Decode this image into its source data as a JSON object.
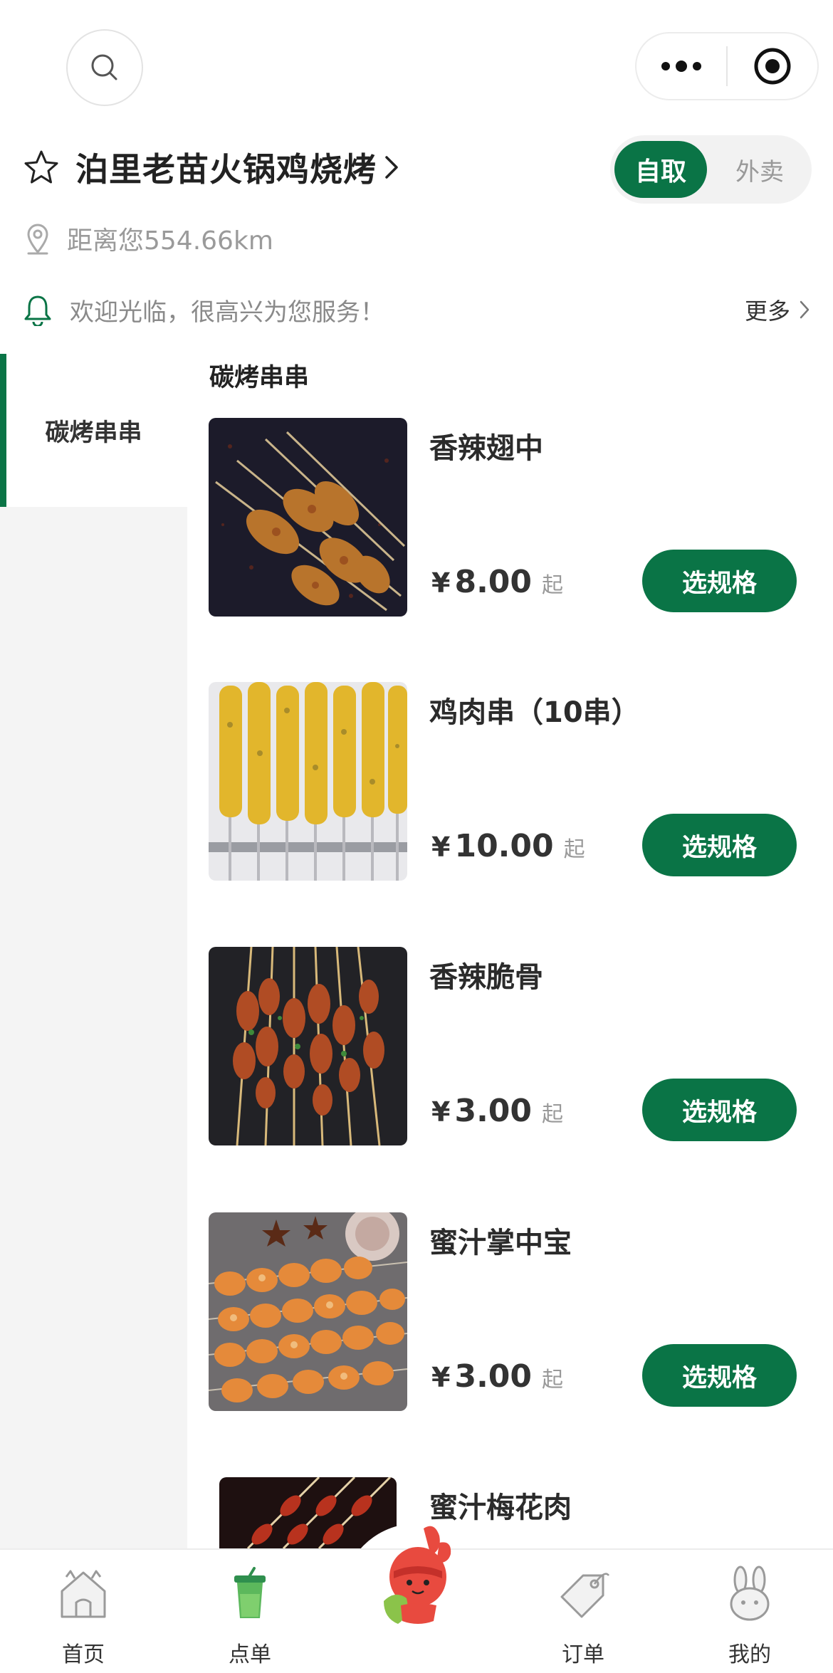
{
  "store": {
    "name": "泊里老苗火锅鸡烧烤",
    "distance": "距离您554.66km",
    "notice": "欢迎光临，很高兴为您服务！",
    "more_label": "更多"
  },
  "mode": {
    "active": "自取",
    "inactive": "外卖"
  },
  "sidebar": {
    "items": [
      {
        "label": "碳烤串串"
      }
    ]
  },
  "section": {
    "title": "碳烤串串"
  },
  "products": [
    {
      "name": "香辣翅中",
      "currency": "¥",
      "price": "8.00",
      "suffix": "起",
      "button": "选规格"
    },
    {
      "name": "鸡肉串（10串）",
      "currency": "¥",
      "price": "10.00",
      "suffix": "起",
      "button": "选规格"
    },
    {
      "name": "香辣脆骨",
      "currency": "¥",
      "price": "3.00",
      "suffix": "起",
      "button": "选规格"
    },
    {
      "name": "蜜汁掌中宝",
      "currency": "¥",
      "price": "3.00",
      "suffix": "起",
      "button": "选规格"
    },
    {
      "name": "蜜汁梅花肉"
    }
  ],
  "tabbar": {
    "items": [
      {
        "label": "首页",
        "icon": "home-icon"
      },
      {
        "label": "点单",
        "icon": "cup-icon"
      },
      {
        "label": "",
        "icon": "mascot-icon"
      },
      {
        "label": "订单",
        "icon": "tag-icon"
      },
      {
        "label": "我的",
        "icon": "bunny-icon"
      }
    ]
  },
  "colors": {
    "accent": "#0a7446",
    "sidebar_bg": "#f4f4f4",
    "muted_text": "#999999"
  }
}
